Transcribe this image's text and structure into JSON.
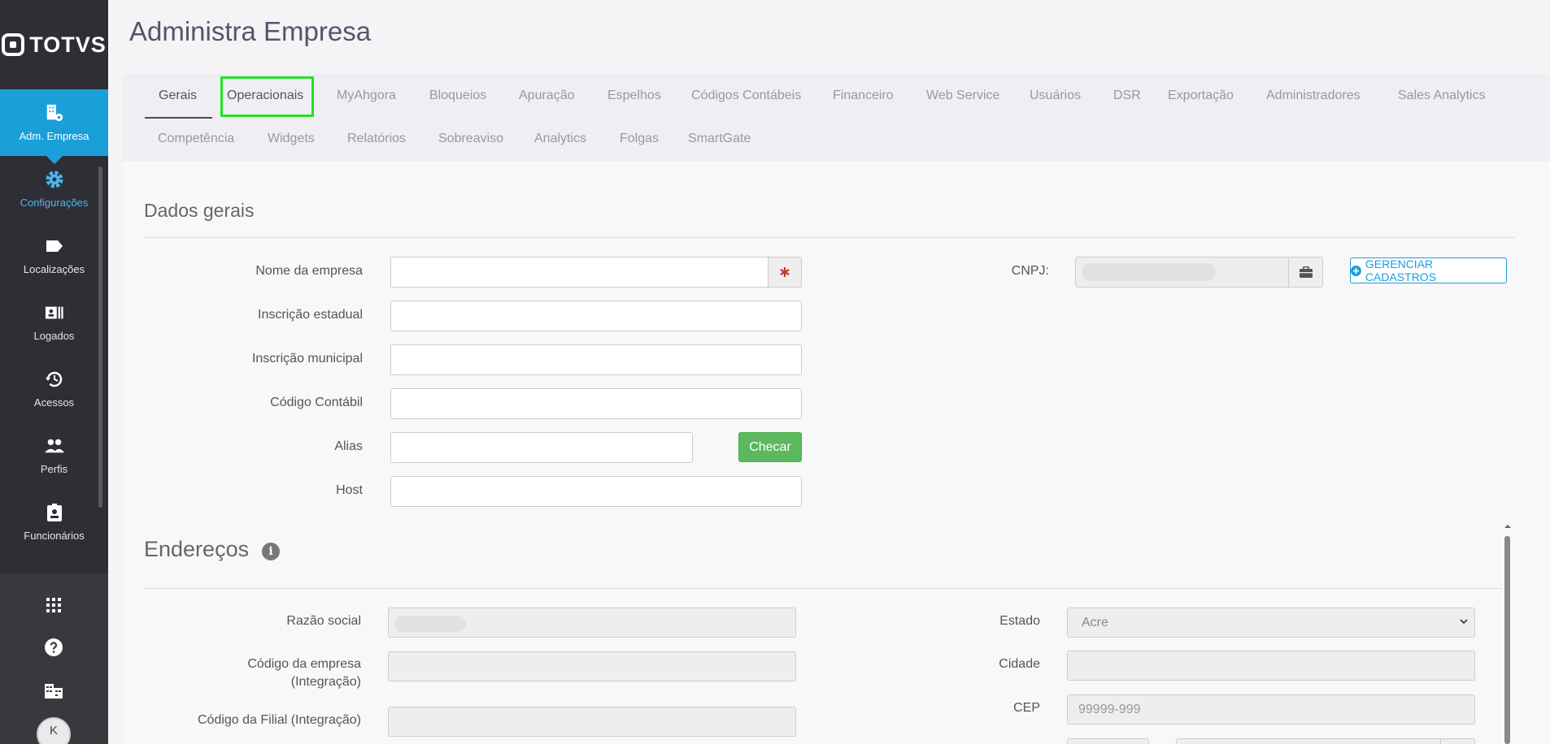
{
  "app": {
    "logo_text": "TOTVS",
    "page_title": "Administra Empresa"
  },
  "sidebar": {
    "items": [
      {
        "label": "Adm. Empresa",
        "icon": "building-gear-icon"
      },
      {
        "label": "Configurações",
        "icon": "gear-icon"
      },
      {
        "label": "Localizações",
        "icon": "tag-icon"
      },
      {
        "label": "Logados",
        "icon": "id-card-icon"
      },
      {
        "label": "Acessos",
        "icon": "history-icon"
      },
      {
        "label": "Perfis",
        "icon": "users-icon"
      },
      {
        "label": "Funcionários",
        "icon": "badge-icon"
      }
    ],
    "avatar_initial": "K"
  },
  "tabs": [
    "Gerais",
    "Operacionais",
    "MyAhgora",
    "Bloqueios",
    "Apuração",
    "Espelhos",
    "Códigos Contábeis",
    "Financeiro",
    "Web Service",
    "Usuários",
    "DSR",
    "Exportação",
    "Administradores",
    "Sales Analytics",
    "Competência",
    "Widgets",
    "Relatórios",
    "Sobreaviso",
    "Analytics",
    "Folgas",
    "SmartGate"
  ],
  "dados_gerais": {
    "title": "Dados gerais",
    "nome_empresa": "Nome da empresa",
    "inscricao_estadual": "Inscrição estadual",
    "inscricao_municipal": "Inscrição municipal",
    "codigo_contabil": "Código Contábil",
    "alias": "Alias",
    "host": "Host",
    "checar_button": "Checar",
    "cnpj": "CNPJ:",
    "gerenciar_button": "GERENCIAR CADASTROS"
  },
  "enderecos": {
    "title": "Endereços",
    "info_glyph": "i",
    "razao_social": "Razão social",
    "codigo_empresa_l1": "Código da empresa",
    "codigo_empresa_l2": "(Integração)",
    "codigo_filial": "Código da Filial (Integração)",
    "estado": "Estado",
    "estado_value": "Acre",
    "cidade": "Cidade",
    "cep": "CEP",
    "cep_placeholder": "99999-999"
  }
}
